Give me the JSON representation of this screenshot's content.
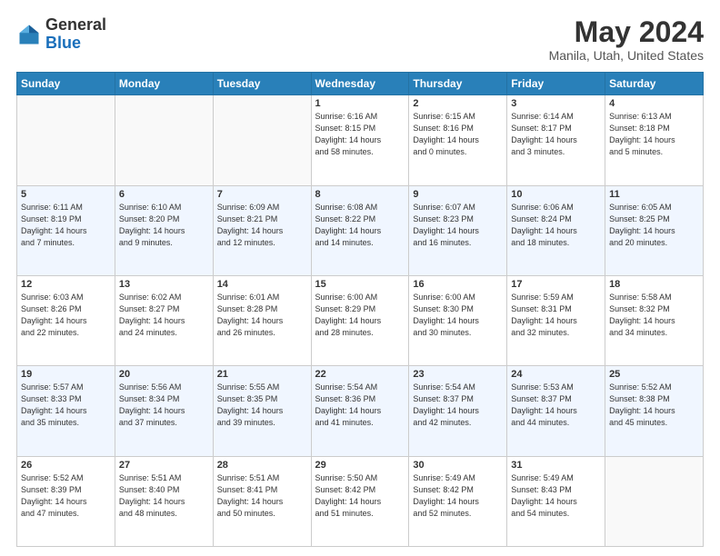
{
  "header": {
    "logo_general": "General",
    "logo_blue": "Blue",
    "month_title": "May 2024",
    "location": "Manila, Utah, United States"
  },
  "days_of_week": [
    "Sunday",
    "Monday",
    "Tuesday",
    "Wednesday",
    "Thursday",
    "Friday",
    "Saturday"
  ],
  "weeks": [
    [
      {
        "day": "",
        "info": ""
      },
      {
        "day": "",
        "info": ""
      },
      {
        "day": "",
        "info": ""
      },
      {
        "day": "1",
        "info": "Sunrise: 6:16 AM\nSunset: 8:15 PM\nDaylight: 14 hours\nand 58 minutes."
      },
      {
        "day": "2",
        "info": "Sunrise: 6:15 AM\nSunset: 8:16 PM\nDaylight: 14 hours\nand 0 minutes."
      },
      {
        "day": "3",
        "info": "Sunrise: 6:14 AM\nSunset: 8:17 PM\nDaylight: 14 hours\nand 3 minutes."
      },
      {
        "day": "4",
        "info": "Sunrise: 6:13 AM\nSunset: 8:18 PM\nDaylight: 14 hours\nand 5 minutes."
      }
    ],
    [
      {
        "day": "5",
        "info": "Sunrise: 6:11 AM\nSunset: 8:19 PM\nDaylight: 14 hours\nand 7 minutes."
      },
      {
        "day": "6",
        "info": "Sunrise: 6:10 AM\nSunset: 8:20 PM\nDaylight: 14 hours\nand 9 minutes."
      },
      {
        "day": "7",
        "info": "Sunrise: 6:09 AM\nSunset: 8:21 PM\nDaylight: 14 hours\nand 12 minutes."
      },
      {
        "day": "8",
        "info": "Sunrise: 6:08 AM\nSunset: 8:22 PM\nDaylight: 14 hours\nand 14 minutes."
      },
      {
        "day": "9",
        "info": "Sunrise: 6:07 AM\nSunset: 8:23 PM\nDaylight: 14 hours\nand 16 minutes."
      },
      {
        "day": "10",
        "info": "Sunrise: 6:06 AM\nSunset: 8:24 PM\nDaylight: 14 hours\nand 18 minutes."
      },
      {
        "day": "11",
        "info": "Sunrise: 6:05 AM\nSunset: 8:25 PM\nDaylight: 14 hours\nand 20 minutes."
      }
    ],
    [
      {
        "day": "12",
        "info": "Sunrise: 6:03 AM\nSunset: 8:26 PM\nDaylight: 14 hours\nand 22 minutes."
      },
      {
        "day": "13",
        "info": "Sunrise: 6:02 AM\nSunset: 8:27 PM\nDaylight: 14 hours\nand 24 minutes."
      },
      {
        "day": "14",
        "info": "Sunrise: 6:01 AM\nSunset: 8:28 PM\nDaylight: 14 hours\nand 26 minutes."
      },
      {
        "day": "15",
        "info": "Sunrise: 6:00 AM\nSunset: 8:29 PM\nDaylight: 14 hours\nand 28 minutes."
      },
      {
        "day": "16",
        "info": "Sunrise: 6:00 AM\nSunset: 8:30 PM\nDaylight: 14 hours\nand 30 minutes."
      },
      {
        "day": "17",
        "info": "Sunrise: 5:59 AM\nSunset: 8:31 PM\nDaylight: 14 hours\nand 32 minutes."
      },
      {
        "day": "18",
        "info": "Sunrise: 5:58 AM\nSunset: 8:32 PM\nDaylight: 14 hours\nand 34 minutes."
      }
    ],
    [
      {
        "day": "19",
        "info": "Sunrise: 5:57 AM\nSunset: 8:33 PM\nDaylight: 14 hours\nand 35 minutes."
      },
      {
        "day": "20",
        "info": "Sunrise: 5:56 AM\nSunset: 8:34 PM\nDaylight: 14 hours\nand 37 minutes."
      },
      {
        "day": "21",
        "info": "Sunrise: 5:55 AM\nSunset: 8:35 PM\nDaylight: 14 hours\nand 39 minutes."
      },
      {
        "day": "22",
        "info": "Sunrise: 5:54 AM\nSunset: 8:36 PM\nDaylight: 14 hours\nand 41 minutes."
      },
      {
        "day": "23",
        "info": "Sunrise: 5:54 AM\nSunset: 8:37 PM\nDaylight: 14 hours\nand 42 minutes."
      },
      {
        "day": "24",
        "info": "Sunrise: 5:53 AM\nSunset: 8:37 PM\nDaylight: 14 hours\nand 44 minutes."
      },
      {
        "day": "25",
        "info": "Sunrise: 5:52 AM\nSunset: 8:38 PM\nDaylight: 14 hours\nand 45 minutes."
      }
    ],
    [
      {
        "day": "26",
        "info": "Sunrise: 5:52 AM\nSunset: 8:39 PM\nDaylight: 14 hours\nand 47 minutes."
      },
      {
        "day": "27",
        "info": "Sunrise: 5:51 AM\nSunset: 8:40 PM\nDaylight: 14 hours\nand 48 minutes."
      },
      {
        "day": "28",
        "info": "Sunrise: 5:51 AM\nSunset: 8:41 PM\nDaylight: 14 hours\nand 50 minutes."
      },
      {
        "day": "29",
        "info": "Sunrise: 5:50 AM\nSunset: 8:42 PM\nDaylight: 14 hours\nand 51 minutes."
      },
      {
        "day": "30",
        "info": "Sunrise: 5:49 AM\nSunset: 8:42 PM\nDaylight: 14 hours\nand 52 minutes."
      },
      {
        "day": "31",
        "info": "Sunrise: 5:49 AM\nSunset: 8:43 PM\nDaylight: 14 hours\nand 54 minutes."
      },
      {
        "day": "",
        "info": ""
      }
    ]
  ]
}
